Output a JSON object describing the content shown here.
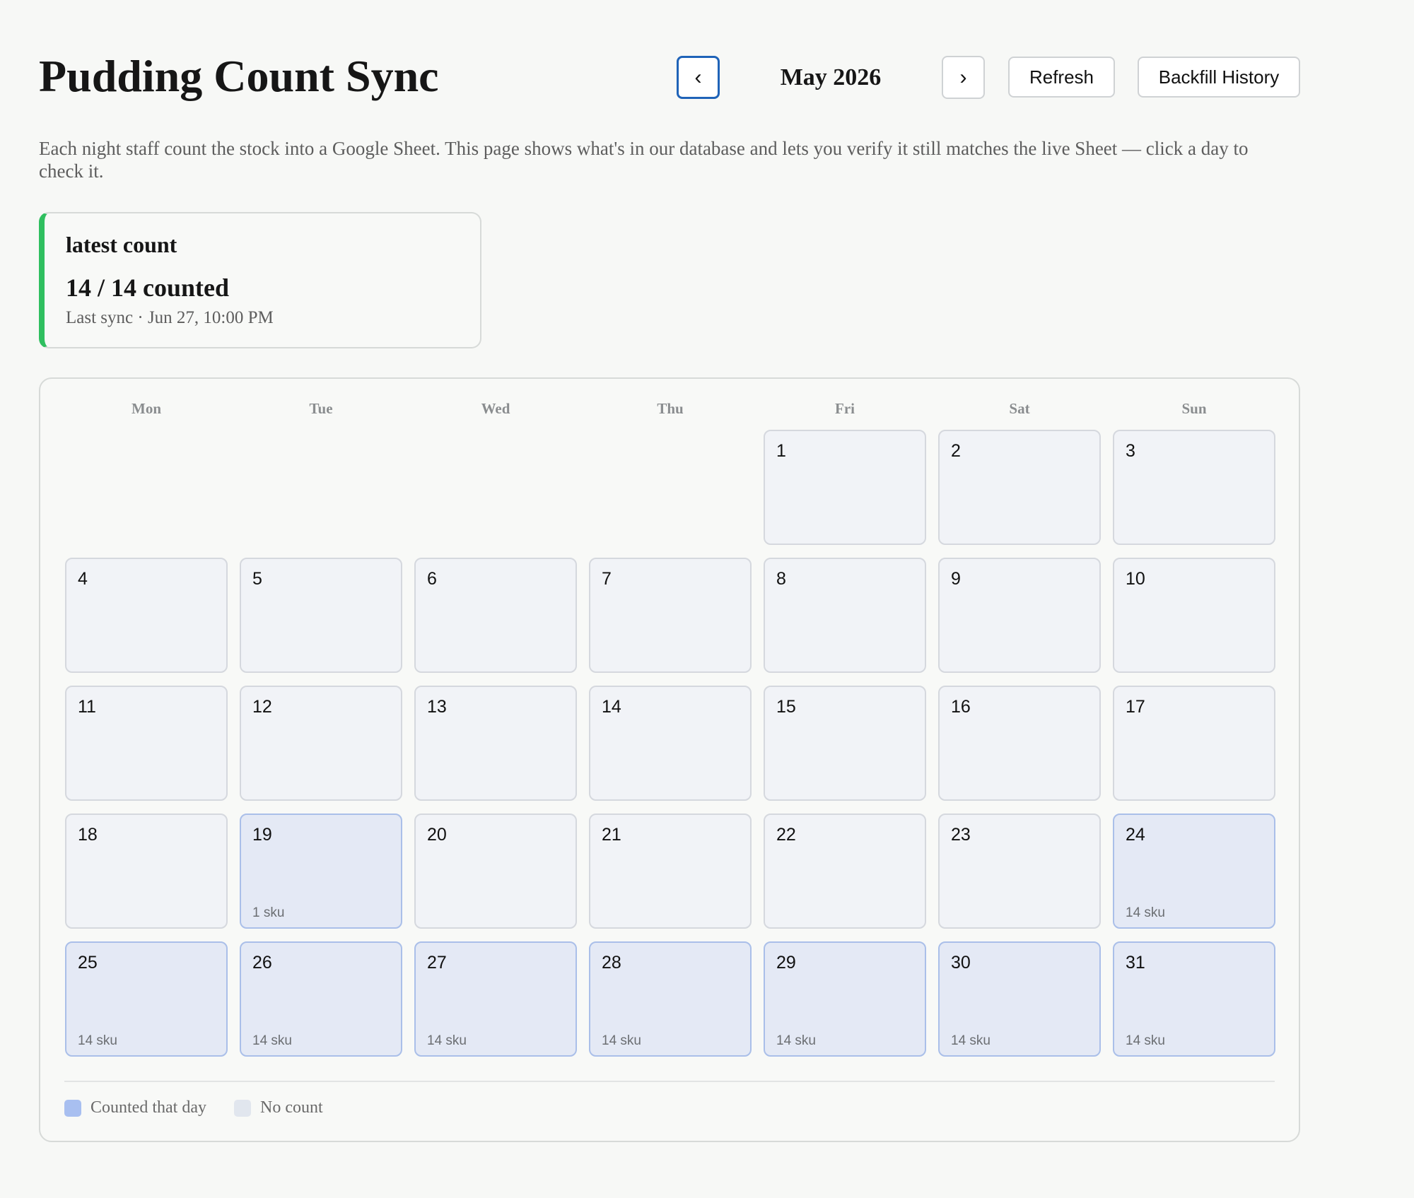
{
  "header": {
    "title": "Pudding Count Sync",
    "prev_label": "‹",
    "next_label": "›",
    "month_label": "May 2026",
    "refresh_label": "Refresh",
    "backfill_label": "Backfill History"
  },
  "intro": "Each night staff count the stock into a Google Sheet. This page shows what's in our database and lets you verify it still matches the live Sheet — click a day to check it.",
  "summary": {
    "label": "latest count",
    "value": "14 / 14 counted",
    "last_sync": "Last sync · Jun 27, 10:00 PM",
    "accent_color": "#2fbf5f"
  },
  "calendar": {
    "weekdays": [
      "Mon",
      "Tue",
      "Wed",
      "Thu",
      "Fri",
      "Sat",
      "Sun"
    ],
    "first_weekday_index": 4,
    "days": [
      {
        "day": "1",
        "sku": ""
      },
      {
        "day": "2",
        "sku": ""
      },
      {
        "day": "3",
        "sku": ""
      },
      {
        "day": "4",
        "sku": ""
      },
      {
        "day": "5",
        "sku": ""
      },
      {
        "day": "6",
        "sku": ""
      },
      {
        "day": "7",
        "sku": ""
      },
      {
        "day": "8",
        "sku": ""
      },
      {
        "day": "9",
        "sku": ""
      },
      {
        "day": "10",
        "sku": ""
      },
      {
        "day": "11",
        "sku": ""
      },
      {
        "day": "12",
        "sku": ""
      },
      {
        "day": "13",
        "sku": ""
      },
      {
        "day": "14",
        "sku": ""
      },
      {
        "day": "15",
        "sku": ""
      },
      {
        "day": "16",
        "sku": ""
      },
      {
        "day": "17",
        "sku": ""
      },
      {
        "day": "18",
        "sku": ""
      },
      {
        "day": "19",
        "sku": "1 sku"
      },
      {
        "day": "20",
        "sku": ""
      },
      {
        "day": "21",
        "sku": ""
      },
      {
        "day": "22",
        "sku": ""
      },
      {
        "day": "23",
        "sku": ""
      },
      {
        "day": "24",
        "sku": "14 sku"
      },
      {
        "day": "25",
        "sku": "14 sku"
      },
      {
        "day": "26",
        "sku": "14 sku"
      },
      {
        "day": "27",
        "sku": "14 sku"
      },
      {
        "day": "28",
        "sku": "14 sku"
      },
      {
        "day": "29",
        "sku": "14 sku"
      },
      {
        "day": "30",
        "sku": "14 sku"
      },
      {
        "day": "31",
        "sku": "14 sku"
      }
    ]
  },
  "legend": {
    "counted_label": "Counted that day",
    "none_label": "No count",
    "counted_color": "#a8bff0",
    "none_color": "#e1e6ee"
  }
}
